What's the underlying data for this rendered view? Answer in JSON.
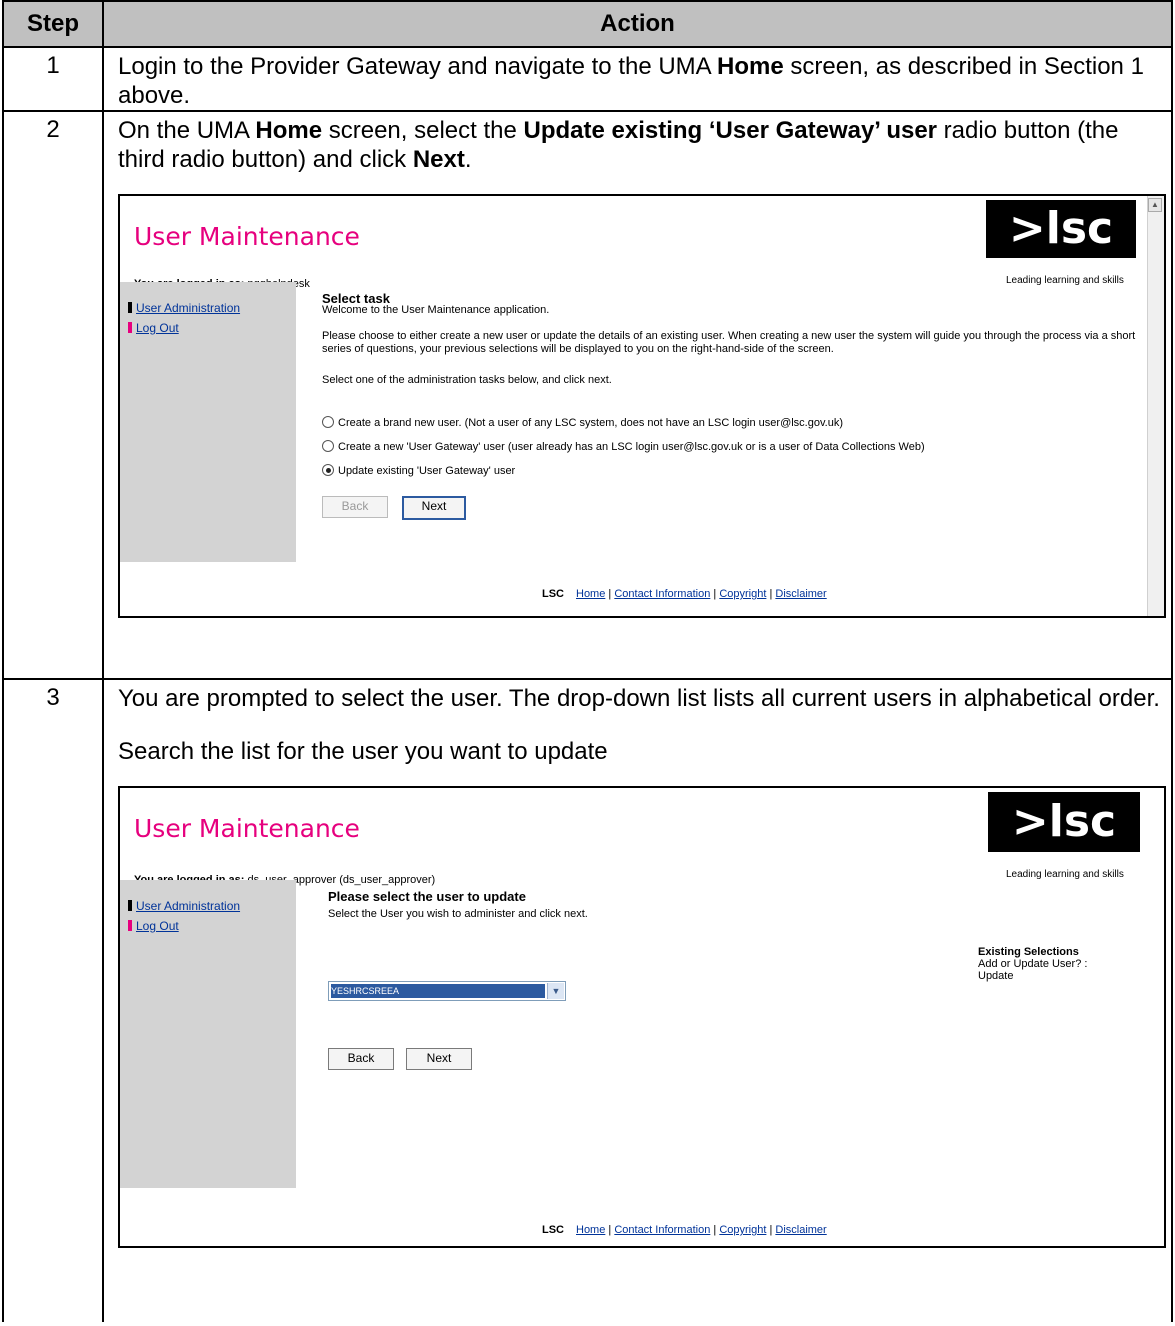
{
  "table": {
    "header_step": "Step",
    "header_action": "Action"
  },
  "step1": {
    "number": "1",
    "text_a": "Login to the Provider Gateway and navigate to the UMA ",
    "text_bold": "Home",
    "text_b": " screen, as described in Section 1 above."
  },
  "step2": {
    "number": "2",
    "text_a": "On the UMA ",
    "text_bold1": "Home",
    "text_b": " screen, select the ",
    "text_bold2": "Update existing ‘User Gateway’ user",
    "text_c": " radio button (the third radio button) and click ",
    "text_bold3": "Next",
    "text_d": "."
  },
  "step3": {
    "number": "3",
    "text_a": "You are prompted to select the user.  The drop-down list lists all current users in alphabetical order.",
    "text_b": "Search the list for the user you want to update"
  },
  "shot1": {
    "title": "User Maintenance",
    "logo": ">lsc",
    "tagline": "Leading learning and skills",
    "logged_label": "You are logged in as:",
    "logged_user": " pqghelpdesk",
    "sidebar_admin": "User Administration",
    "sidebar_logout": "Log Out",
    "heading": "Select task",
    "welcome": "Welcome to the User Maintenance application.",
    "instructions": "Please choose to either create a new user or update the details of an existing user. When creating a new user the system will guide you through the process via a short series of questions, your previous selections will be displayed to you on the right-hand-side of the screen.",
    "select_prompt": "Select one of the administration tasks below, and click next.",
    "radio1": "Create a brand new user. (Not a user of any LSC system, does not have an LSC login user@lsc.gov.uk)",
    "radio2": "Create a new 'User Gateway' user (user already has an LSC login user@lsc.gov.uk or is a user of Data Collections Web)",
    "radio3": "Update existing 'User Gateway' user",
    "back": "Back",
    "next": "Next",
    "footer_lsc": "LSC",
    "footer_home": "Home",
    "footer_contact": "Contact Information",
    "footer_copyright": "Copyright",
    "footer_disclaimer": "Disclaimer",
    "sep": " | "
  },
  "shot2": {
    "title": "User Maintenance",
    "logo": ">lsc",
    "tagline": "Leading learning and skills",
    "logged_label": "You are logged in as:",
    "logged_user": " ds_user_approver (ds_user_approver)",
    "sidebar_admin": "User Administration",
    "sidebar_logout": "Log Out",
    "heading": "Please select the user to update",
    "instruction": "Select the User you wish to administer and click next.",
    "selected_user": "YESHRCSREEA",
    "back": "Back",
    "next": "Next",
    "existing_title": "Existing Selections",
    "existing_q": "Add or Update User? :",
    "existing_a": "Update",
    "footer_lsc": "LSC",
    "footer_home": "Home",
    "footer_contact": "Contact Information",
    "footer_copyright": "Copyright",
    "footer_disclaimer": "Disclaimer",
    "sep": " | "
  }
}
